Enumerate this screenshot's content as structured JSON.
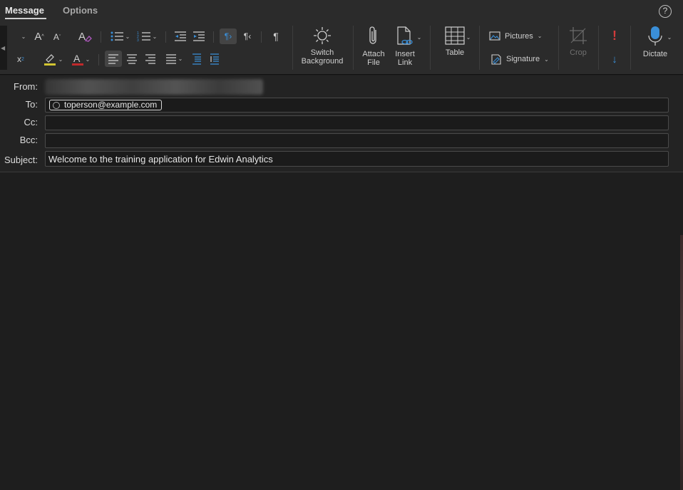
{
  "tabs": [
    {
      "label": "Message",
      "active": true
    },
    {
      "label": "Options",
      "active": false
    }
  ],
  "ribbon": {
    "switch_background": {
      "line1": "Switch",
      "line2": "Background"
    },
    "attach_file": {
      "line1": "Attach",
      "line2": "File"
    },
    "insert_link": {
      "line1": "Insert",
      "line2": "Link"
    },
    "table": "Table",
    "pictures": "Pictures",
    "signature": "Signature",
    "crop": "Crop",
    "dictate": "Dictate",
    "colors": {
      "highlight": "#d2c531",
      "font_color": "#c0292b",
      "accent_blue": "#3a8fd8",
      "importance_red": "#d23b3b"
    }
  },
  "header": {
    "from_label": "From:",
    "to_label": "To:",
    "cc_label": "Cc:",
    "bcc_label": "Bcc:",
    "subject_label": "Subject:",
    "to_recipient": "toperson@example.com",
    "cc_value": "",
    "bcc_value": "",
    "subject_value": "Welcome to the training application for Edwin Analytics"
  },
  "help_icon": "?"
}
